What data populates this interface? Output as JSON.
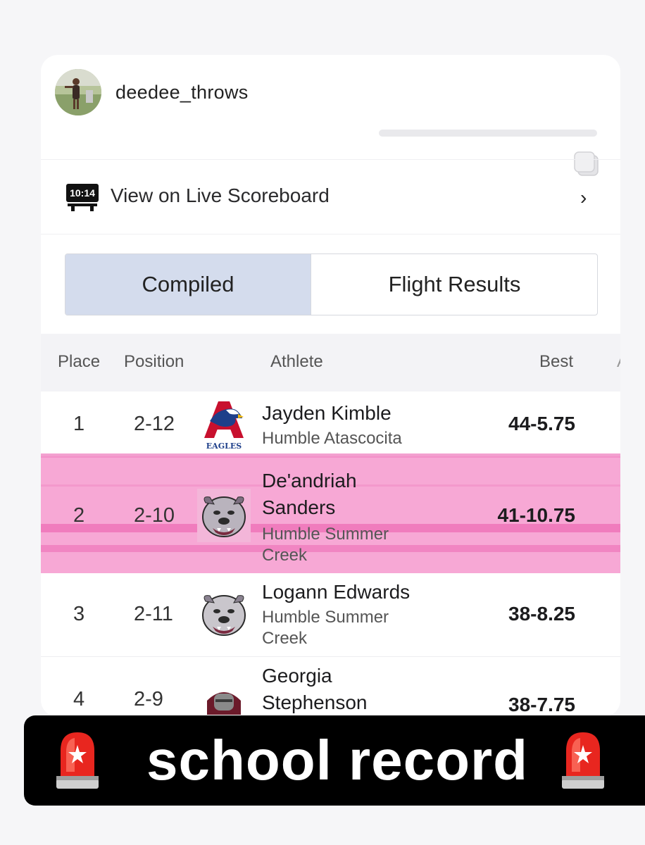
{
  "post": {
    "username": "deedee_throws",
    "avatar_icon": "profile-photo-avatar"
  },
  "scoreboard": {
    "clock_text": "10:14",
    "label": "View on Live Scoreboard",
    "chevron": "›"
  },
  "tabs": [
    {
      "label": "Compiled",
      "selected": true
    },
    {
      "label": "Flight Results",
      "selected": false
    }
  ],
  "table": {
    "headers": {
      "place": "Place",
      "position": "Position",
      "athlete": "Athlete",
      "best": "Best",
      "more": "A"
    },
    "rows": [
      {
        "place": "1",
        "position": "2-12",
        "name": "Jayden Kimble",
        "school": "Humble Atascocita",
        "best": "44-5.75",
        "logo": "atascocita-eagles-logo",
        "logo_text": "EAGLES",
        "highlighted": false
      },
      {
        "place": "2",
        "position": "2-10",
        "name": "De'andriah Sanders",
        "school": "Humble Summer Creek",
        "best": "41-10.75",
        "logo": "bulldog-logo",
        "highlighted": true
      },
      {
        "place": "3",
        "position": "2-11",
        "name": "Logann Edwards",
        "school": "Humble Summer Creek",
        "best": "38-8.25",
        "logo": "bulldog-logo",
        "highlighted": false
      },
      {
        "place": "4",
        "position": "2-9",
        "name": "Georgia Stephenson",
        "school": "",
        "best": "38-7.75",
        "logo": "knight-logo",
        "highlighted": false
      }
    ]
  },
  "banner": {
    "text": "school record",
    "icon": "police-siren-emoji"
  },
  "colors": {
    "tab_selected": "#d4dced",
    "highlight": "#f7a8d5",
    "banner_bg": "#000000"
  }
}
